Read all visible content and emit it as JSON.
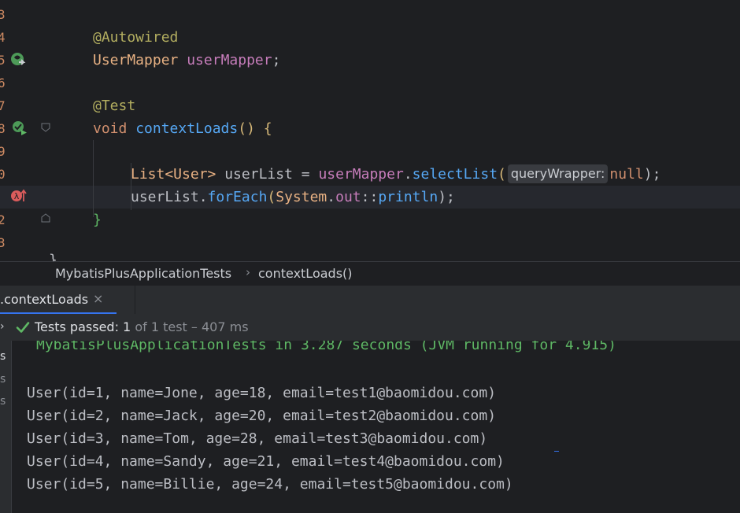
{
  "editor": {
    "line_numbers": [
      "3",
      "4",
      "5",
      "6",
      "7",
      "8",
      "9",
      "0",
      "1",
      "2",
      "3"
    ],
    "lines": [
      [],
      [
        {
          "t": "@Autowired",
          "c": "#b3ae60"
        }
      ],
      [
        {
          "t": "UserMapper ",
          "c": "#e8b183"
        },
        {
          "t": "userMapper",
          "c": "#c77dbb"
        },
        {
          "t": ";",
          "c": "#bcbec4"
        }
      ],
      [],
      [
        {
          "t": "@Test",
          "c": "#b3ae60"
        }
      ],
      [
        {
          "t": "void ",
          "c": "#cf8e6d"
        },
        {
          "t": "contextLoads",
          "c": "#56a8f5"
        },
        {
          "t": "() {",
          "c": "#d5b778"
        }
      ],
      [],
      [
        {
          "t": "List<User> ",
          "c": "#e8b183"
        },
        {
          "t": "userList = ",
          "c": "#bcbec4"
        },
        {
          "t": "userMapper",
          "c": "#c77dbb"
        },
        {
          "t": ".",
          "c": "#bcbec4"
        },
        {
          "t": "selectList",
          "c": "#56a8f5"
        },
        {
          "t": "(",
          "c": "#d5b778"
        },
        {
          "hint": "queryWrapper:"
        },
        {
          "t": "null",
          "c": "#cf8e6d"
        },
        {
          "t": ");",
          "c": "#bcbec4"
        }
      ],
      [
        {
          "t": "userList.",
          "c": "#bcbec4"
        },
        {
          "t": "forEach",
          "c": "#56a8f5"
        },
        {
          "t": "(",
          "c": "#d5b778"
        },
        {
          "t": "System",
          "c": "#e8b183"
        },
        {
          "t": ".",
          "c": "#bcbec4"
        },
        {
          "t": "out",
          "c": "#c77dbb"
        },
        {
          "t": "::",
          "c": "#bcbec4"
        },
        {
          "t": "println",
          "c": "#56a8f5"
        },
        {
          "t": ");",
          "c": "#bcbec4"
        }
      ],
      [
        {
          "t": "}",
          "c": "#5fb865"
        }
      ],
      []
    ],
    "tail_text": "}",
    "colors": {
      "background": "#1e1f22",
      "line_number": "#ce8a63",
      "current_line": "#26282e"
    },
    "gutter_icons": [
      "bean-injection-icon",
      "run-test-icon",
      "lambda-icon"
    ]
  },
  "breadcrumb": {
    "class_name": "MybatisPlusApplicationTests",
    "separator": "›",
    "method_name": "contextLoads()"
  },
  "run_panel": {
    "tab_label": ".contextLoads",
    "tab_close": "×",
    "status": {
      "chevron": "›",
      "passed_label": "Tests passed: ",
      "passed_count": "1",
      "of_label": " of 1 test – 407 ms"
    },
    "tree_labels": [
      "s",
      "s",
      "s"
    ],
    "console": {
      "summary": "MybatisPlusApplicationTests in 3.287 seconds (JVM running for 4.915)",
      "lines": [
        "User(id=1, name=Jone, age=18, email=test1@baomidou.com)",
        "User(id=2, name=Jack, age=20, email=test2@baomidou.com)",
        "User(id=3, name=Tom, age=28, email=test3@baomidou.com)",
        "User(id=4, name=Sandy, age=21, email=test4@baomidou.com)",
        "User(id=5, name=Billie, age=24, email=test5@baomidou.com)"
      ]
    },
    "colors": {
      "accent": "#3574f0",
      "success": "#5fb865",
      "console_text": "#bcbec4"
    }
  }
}
